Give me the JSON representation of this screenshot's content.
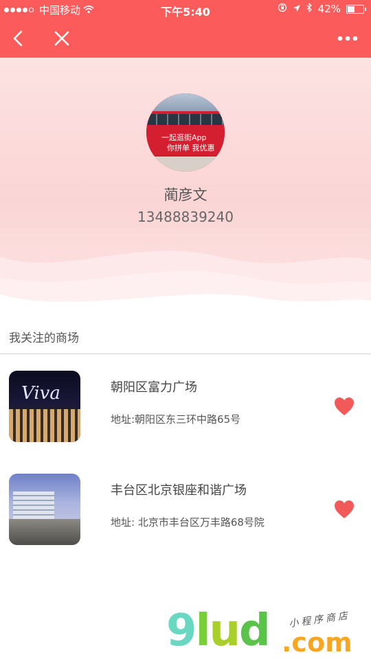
{
  "status_bar": {
    "carrier": "中国移动",
    "time": "下午5:40",
    "battery": "42%",
    "signal_strength": 4
  },
  "nav": {
    "back_icon": "chevron-left-icon",
    "close_icon": "close-icon",
    "more_icon": "more-horizontal-icon"
  },
  "profile": {
    "avatar_text_line1": "一起逛街App",
    "avatar_text_line2": "你拼单 我优惠",
    "name": "蔺彦文",
    "phone": "13488839240"
  },
  "section": {
    "title": "我关注的商场"
  },
  "malls": [
    {
      "name": "朝阳区富力广场",
      "address": "地址:朝阳区东三环中路65号",
      "thumb_sign": "Viva",
      "favorited": true
    },
    {
      "name": "丰台区北京银座和谐广场",
      "address": "地址: 北京市丰台区万丰路68号院",
      "favorited": true
    }
  ],
  "watermark": {
    "brand_g": "9",
    "brand_l": "l",
    "brand_u": "u",
    "brand_d": "d",
    "dotcom": ".com",
    "subtitle": "小程序商店"
  },
  "colors": {
    "primary": "#fc5b5b",
    "heart": "#f25a5a",
    "profile_bg": "#fbd5d5"
  }
}
